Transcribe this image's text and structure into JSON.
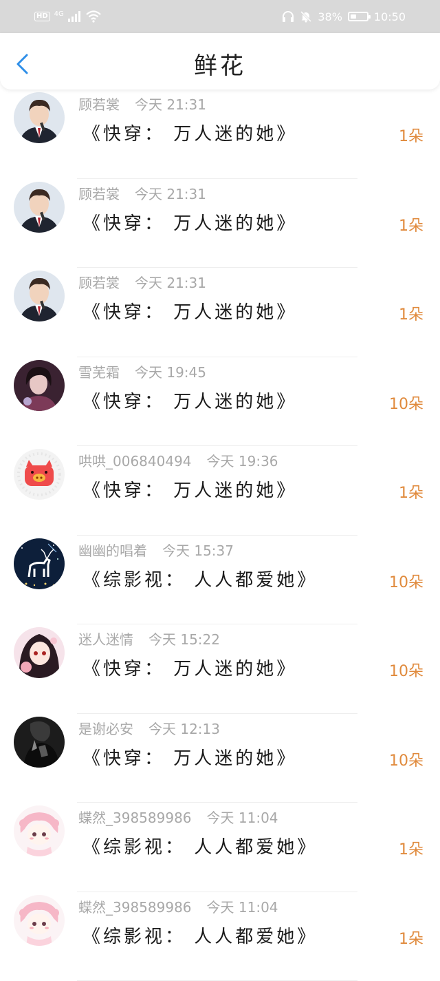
{
  "status_bar": {
    "hd": "HD",
    "network": "4G",
    "battery": "38%",
    "battery_level": 0.38,
    "time": "10:50"
  },
  "header": {
    "title": "鲜花"
  },
  "items": [
    {
      "user": "顾若裳",
      "time": "今天 21:31",
      "book": "《快穿： 万人迷的她》",
      "count": "1朵",
      "avatar": "avatar-man-suit"
    },
    {
      "user": "顾若裳",
      "time": "今天 21:31",
      "book": "《快穿： 万人迷的她》",
      "count": "1朵",
      "avatar": "avatar-man-suit"
    },
    {
      "user": "顾若裳",
      "time": "今天 21:31",
      "book": "《快穿： 万人迷的她》",
      "count": "1朵",
      "avatar": "avatar-man-suit"
    },
    {
      "user": "雪芜霜",
      "time": "今天 19:45",
      "book": "《快穿： 万人迷的她》",
      "count": "10朵",
      "avatar": "avatar-girl-purple"
    },
    {
      "user": "哄哄_006840494",
      "time": "今天 19:36",
      "book": "《快穿： 万人迷的她》",
      "count": "1朵",
      "avatar": "avatar-pig"
    },
    {
      "user": "幽幽的唱着",
      "time": "今天 15:37",
      "book": "《综影视： 人人都爱她》",
      "count": "10朵",
      "avatar": "avatar-deer"
    },
    {
      "user": "迷人迷情",
      "time": "今天 15:22",
      "book": "《快穿： 万人迷的她》",
      "count": "10朵",
      "avatar": "avatar-anime-girl"
    },
    {
      "user": "是谢必安",
      "time": "今天 12:13",
      "book": "《快穿： 万人迷的她》",
      "count": "10朵",
      "avatar": "avatar-dark"
    },
    {
      "user": "蝶然_398589986",
      "time": "今天 11:04",
      "book": "《综影视： 人人都爱她》",
      "count": "1朵",
      "avatar": "avatar-pink-chibi"
    },
    {
      "user": "蝶然_398589986",
      "time": "今天 11:04",
      "book": "《综影视： 人人都爱她》",
      "count": "1朵",
      "avatar": "avatar-pink-chibi"
    }
  ],
  "colors": {
    "accent_back": "#2e8ee8",
    "count": "#e08a3c",
    "meta": "#a8a8a8",
    "status_bg": "#d9d9d9"
  }
}
